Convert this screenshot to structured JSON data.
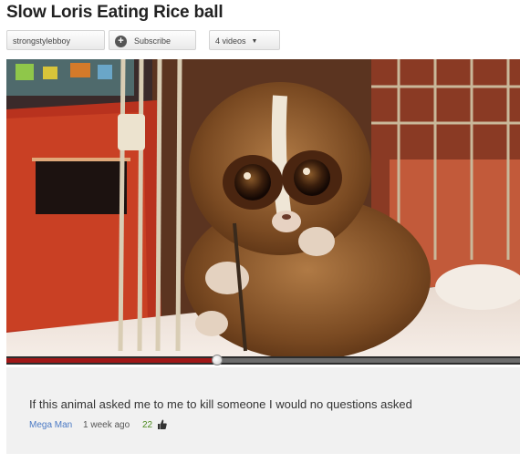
{
  "video": {
    "title": "Slow Loris Eating Rice ball",
    "progress_fraction": 0.41
  },
  "channel": {
    "name": "strongstylebboy",
    "subscribe_label": "Subscribe",
    "videos_label": "4 videos"
  },
  "comment": {
    "text": "If this animal asked me to me to kill someone I would no questions asked",
    "author": "Mega Man",
    "time": "1 week ago",
    "likes": "22"
  },
  "colors": {
    "progress_played": "#a01818",
    "author_link": "#4a79c4",
    "likes": "#4c8a1e"
  }
}
